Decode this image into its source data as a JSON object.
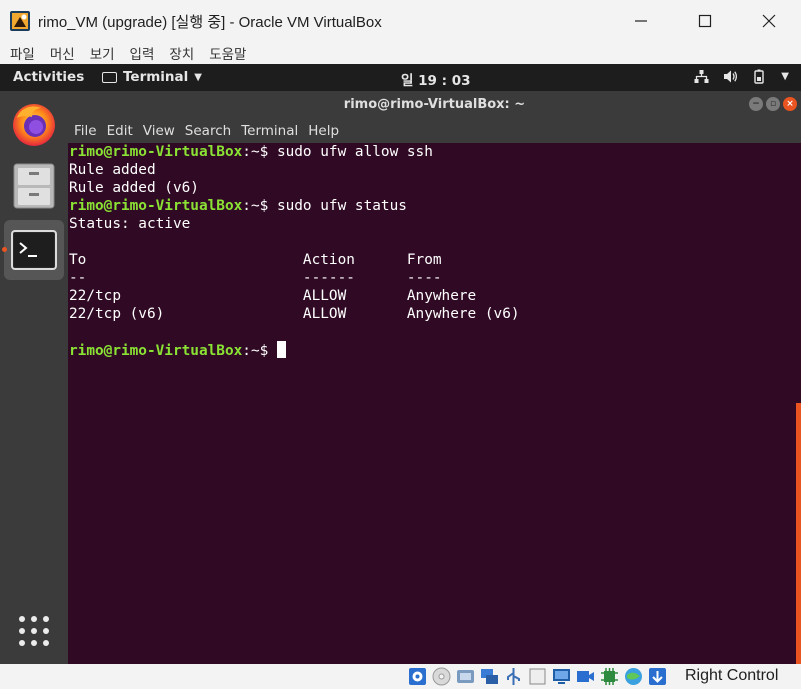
{
  "host": {
    "title": "rimo_VM (upgrade) [실행 중] - Oracle VM VirtualBox",
    "menu": [
      "파일",
      "머신",
      "보기",
      "입력",
      "장치",
      "도움말"
    ],
    "host_key": "Right Control"
  },
  "gnome": {
    "activities": "Activities",
    "app_name": "Terminal",
    "clock": "일 19 : 03"
  },
  "terminal": {
    "title": "rimo@rimo-VirtualBox: ~",
    "menu": [
      "File",
      "Edit",
      "View",
      "Search",
      "Terminal",
      "Help"
    ],
    "prompt": "rimo@rimo-VirtualBox",
    "prompt_tail": ":~$ ",
    "lines": [
      {
        "kind": "cmd",
        "text": "sudo ufw allow ssh"
      },
      {
        "kind": "out",
        "text": "Rule added"
      },
      {
        "kind": "out",
        "text": "Rule added (v6)"
      },
      {
        "kind": "cmd",
        "text": "sudo ufw status"
      },
      {
        "kind": "out",
        "text": "Status: active"
      },
      {
        "kind": "out",
        "text": ""
      },
      {
        "kind": "out",
        "text": "To                         Action      From"
      },
      {
        "kind": "out",
        "text": "--                         ------      ----"
      },
      {
        "kind": "out",
        "text": "22/tcp                     ALLOW       Anywhere"
      },
      {
        "kind": "out",
        "text": "22/tcp (v6)                ALLOW       Anywhere (v6)"
      },
      {
        "kind": "out",
        "text": ""
      },
      {
        "kind": "cmd_cursor",
        "text": ""
      }
    ]
  },
  "colors": {
    "prompt": "#8ae234",
    "terminal_bg": "#300a24",
    "accent": "#e95420"
  }
}
